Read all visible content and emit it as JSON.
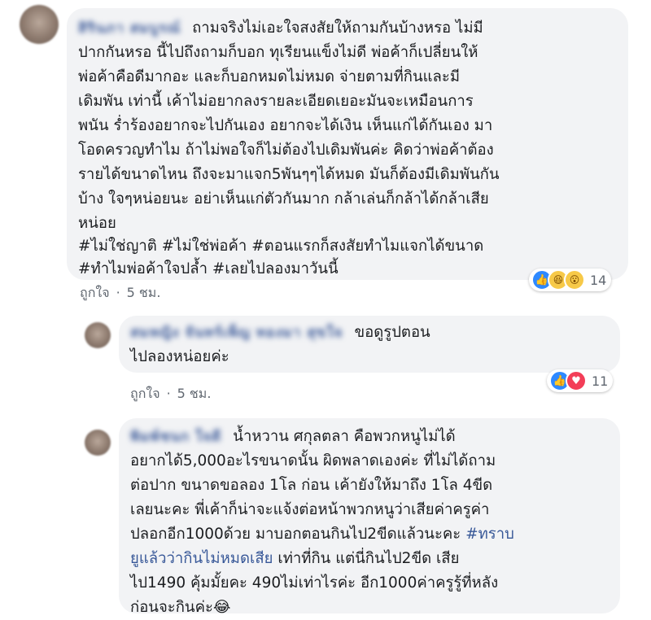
{
  "comments": [
    {
      "author": "สิรินภา สมบูรณ์",
      "lines": [
        "ถามจริงไม่เอะใจสงสัยให้ถามกันบ้างหรอ ไม่มี",
        "ปากกันหรอ นี้ไปถึงถามก็บอก ทุเรียนแข็งไม่ดี พ่อค้าก็เปลี่ยนให้",
        "พ่อค้าคือดีมากอะ และก็บอกหมดไม่หมด จ่ายตามที่กินและมี",
        "เดิมพัน เท่านี้ เค้าไม่อยากลงรายละเอียดเยอะมันจะเหมือนการ",
        "พนัน ร่ำร้องอยากจะไปกันเอง อยากจะได้เงิน เห็นแก่ได้กันเอง มา",
        "โอดครวญทำไม ถ้าไม่พอใจก็ไม่ต้องไปเดิมพันค่ะ คิดว่าพ่อค้าต้อง",
        "รายได้ขนาดไหน ถึงจะมาแจก5พันๆๆได้หมด มันก็ต้องมีเดิมพันกัน",
        "บ้าง ใจๆหน่อยนะ อย่าเห็นแก่ตัวกันมาก กล้าเล่นก็กล้าได้กล้าเสีย",
        "หน่อย"
      ],
      "hashtags": [
        "#ไม่ใช่ญาติ #ไม่ใช่พ่อค้า #ตอนแรกก็สงสัยทำไมแจกได้ขนาด",
        "#ทำไมพ่อค้าใจปล้ำ #เลยไปลองมาวันนี้"
      ],
      "like_label": "ถูกใจ",
      "dot": "·",
      "time": "5 ชม.",
      "reactions": [
        "like-icon",
        "haha-icon",
        "wow-icon"
      ],
      "reaction_count": "14"
    },
    {
      "author": "สมหญิง จันทร์เพ็ญ ทองมา สุขใจ",
      "lines": [
        "ขอดูรูปตอน",
        "ไปลองหน่อยค่ะ"
      ],
      "like_label": "ถูกใจ",
      "dot": "·",
      "time": "5 ชม.",
      "reactions": [
        "like-icon",
        "love-icon"
      ],
      "reaction_count": "11"
    },
    {
      "author": "พิมพ์ชนก ใจดี",
      "lines": [
        "น้ำหวาน ศกุลตลา คือพวกหนูไม่ได้",
        "อยากได้5,000อะไรขนาดนั้น ผิดพลาดเองค่ะ ที่ไม่ได้ถาม",
        "ต่อปาก ขนาดขอลอง 1โล ก่อน เค้ายังให้มาถึง 1โล 4ขีด",
        "เลยนะคะ พี่เค้าก็น่าจะแจ้งต่อหน้าพวกหนูว่าเสียค่าครูค่า",
        "ปลอกอีก1000ด้วย มาบอกตอนกินไป2ขีดแล้วนะคะ",
        "ยูแล้วว่ากินไม่หมดเสีย",
        "ไป1490 คุ้มมั้ยคะ 490ไม่เท่าไรค่ะ อีก1000ค่าครูรู้ที่หลัง",
        "ก่อนจะกินค่ะ😂"
      ],
      "hashtag_1": "#ทราบ",
      "hashtag_2": "ยูแล้วว่ากินไม่หมดเสีย",
      "line6_tail": " เท่าที่กิน แต่นี่กินไป2ขีด เสีย"
    }
  ]
}
